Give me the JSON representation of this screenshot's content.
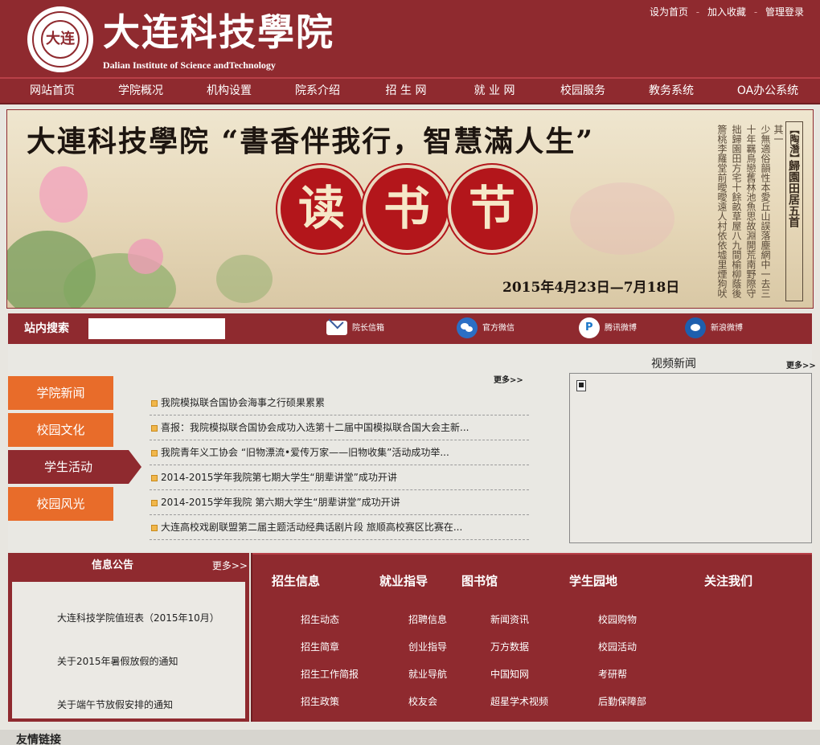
{
  "header": {
    "logo_seal_text": "大连",
    "logo_cn": "大连科技學院",
    "logo_en": "Dalian Institute of Science andTechnology",
    "top_links": [
      "设为首页",
      "加入收藏",
      "管理登录"
    ],
    "top_sep": "-"
  },
  "nav": {
    "items": [
      "网站首页",
      "学院概况",
      "机构设置",
      "院系介绍",
      "招 生 网",
      "就 业 网",
      "校园服务",
      "教务系统",
      "OA办公系统"
    ]
  },
  "banner": {
    "title": "大連科技學院 “書香伴我行，智慧滿人生”",
    "circles": [
      "读",
      "书",
      "节"
    ],
    "date": "2015年4月23日—7月18日",
    "poem_title": "歸園田居五首",
    "poem_author": "【陶潛】",
    "poem_lines": [
      "其一",
      "少無適俗韻性本愛丘山誤落塵網中一去三",
      "十年羈鳥戀舊林池魚思故淵開荒南野際守",
      "拙歸園田方宅十餘畝草屋八九間榆柳蔭後",
      "簷桃李羅堂前曖曖遠人村依依墟里煙狗吠"
    ]
  },
  "searchbar": {
    "label": "站内搜索",
    "input_value": "",
    "input_placeholder": "",
    "items": [
      {
        "label": "院长信箱",
        "icon": "mail-icon"
      },
      {
        "label": "官方微信",
        "icon": "wechat-icon"
      },
      {
        "label": "腾讯微博",
        "icon": "tencent-weibo-icon"
      },
      {
        "label": "新浪微博",
        "icon": "sina-weibo-icon"
      }
    ]
  },
  "tabs": {
    "items": [
      "学院新闻",
      "校园文化",
      "学生活动",
      "校园风光"
    ],
    "active_index": 2
  },
  "news": {
    "more": "更多>>",
    "items": [
      "我院模拟联合国协会海事之行硕果累累",
      "喜报：我院模拟联合国协会成功入选第十二届中国模拟联合国大会主新...",
      "我院青年义工协会 “旧物漂流•爱传万家——旧物收集”活动成功举...",
      "2014-2015学年我院第七期大学生“朋辈讲堂”成功开讲",
      "2014-2015学年我院 第六期大学生“朋辈讲堂”成功开讲",
      "大连高校戏剧联盟第二届主题活动经典话剧片段 旅顺高校赛区比赛在..."
    ]
  },
  "video": {
    "title": "视频新闻",
    "more": "更多>>"
  },
  "notice": {
    "title": "信息公告",
    "more": "更多>>",
    "items": [
      "大连科技学院值班表（2015年10月）",
      "关于2015年暑假放假的通知",
      "关于端午节放假安排的通知"
    ]
  },
  "links": {
    "columns": [
      {
        "head": "招生信息",
        "items": [
          "招生动态",
          "招生简章",
          "招生工作简报",
          "招生政策"
        ]
      },
      {
        "head": "就业指导",
        "items": [
          "招聘信息",
          "创业指导",
          "就业导航",
          "校友会"
        ]
      },
      {
        "head": "图书馆",
        "items": [
          "新闻资讯",
          "万方数据",
          "中国知网",
          "超星学术视频"
        ]
      },
      {
        "head": "学生园地",
        "items": [
          "校园购物",
          "校园活动",
          "考研帮",
          "后勤保障部"
        ]
      },
      {
        "head": "关注我们",
        "items": []
      }
    ]
  },
  "friend_links": {
    "label": "友情链接"
  },
  "colors": {
    "brand": "#8f2a2f",
    "tab_orange": "#e86c2a",
    "bg": "#e8e6e0"
  }
}
